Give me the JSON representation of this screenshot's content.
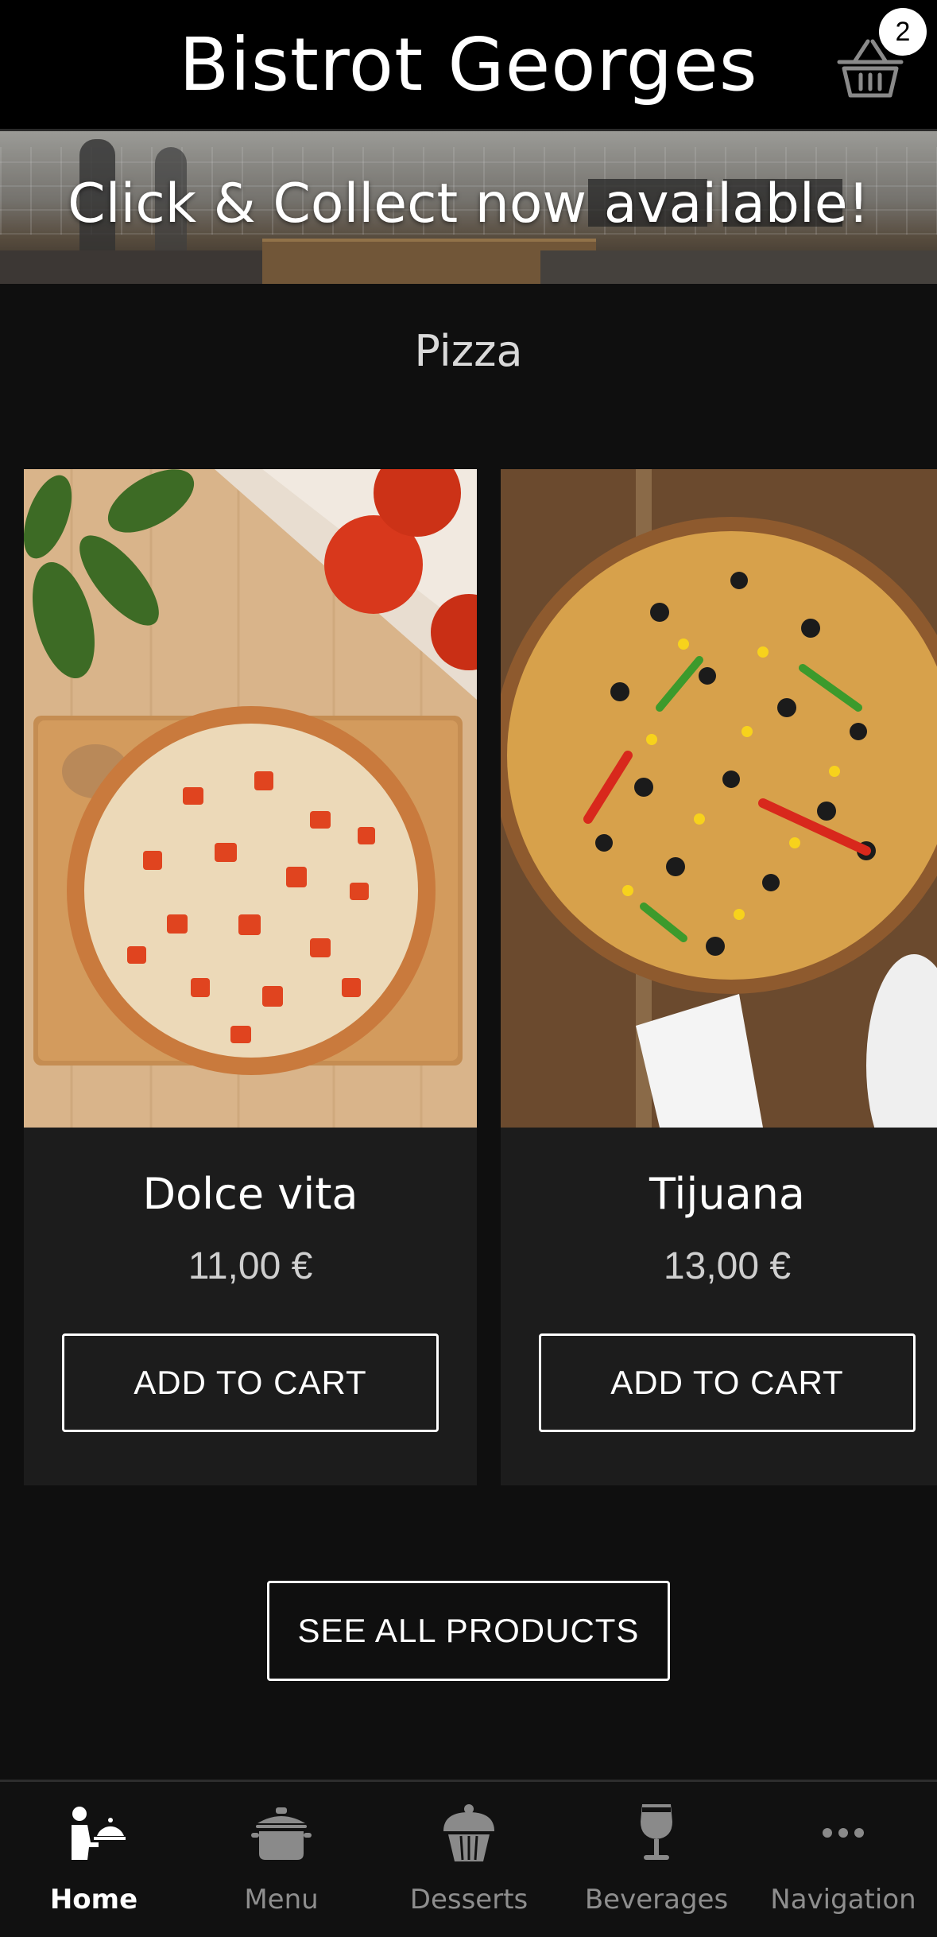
{
  "header": {
    "title": "Bistrot Georges",
    "cart_count": "2",
    "cart_icon": "basket-icon"
  },
  "banner": {
    "text": "Click & Collect now available!"
  },
  "section": {
    "title": "Pizza"
  },
  "products": [
    {
      "name": "Dolce vita",
      "price": "11,00 €",
      "button": "ADD TO CART"
    },
    {
      "name": "Tijuana",
      "price": "13,00 €",
      "button": "ADD TO CART"
    }
  ],
  "see_all": {
    "label": "SEE ALL PRODUCTS"
  },
  "bottom_nav": {
    "items": [
      {
        "label": "Home",
        "icon": "waiter-icon",
        "active": true
      },
      {
        "label": "Menu",
        "icon": "pot-icon",
        "active": false
      },
      {
        "label": "Desserts",
        "icon": "cupcake-icon",
        "active": false
      },
      {
        "label": "Beverages",
        "icon": "wine-glass-icon",
        "active": false
      },
      {
        "label": "Navigation",
        "icon": "more-dots-icon",
        "active": false
      }
    ]
  },
  "colors": {
    "background": "#0f0f0f",
    "header": "#000000",
    "card": "#1c1c1c",
    "active_nav": "#ffffff",
    "inactive_nav": "#8e8e8e"
  }
}
